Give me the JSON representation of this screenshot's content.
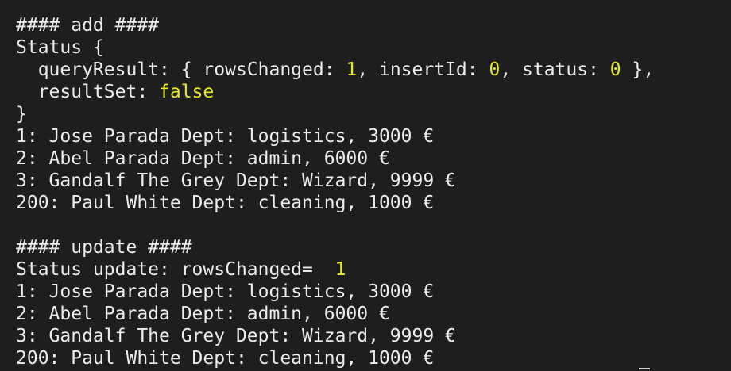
{
  "terminal": {
    "lines": {
      "add_header": "#### add ####",
      "status_open": "Status {",
      "query_result_prefix": "  queryResult: { rowsChanged: ",
      "rows_changed": "1",
      "insert_id_prefix": ", insertId: ",
      "insert_id": "0",
      "status_prefix": ", status: ",
      "status_value": "0",
      "query_result_suffix": " },",
      "result_set_prefix": "  resultSet: ",
      "result_set_value": "false",
      "status_close": "}",
      "rows_after_add": [
        "1: Jose Parada Dept: logistics, 3000 €",
        "2: Abel Parada Dept: admin, 6000 €",
        "3: Gandalf The Grey Dept: Wizard, 9999 €",
        "200: Paul White Dept: cleaning, 1000 €"
      ],
      "blank": "",
      "update_header": "#### update ####",
      "status_update_prefix": "Status update: rowsChanged=  ",
      "status_update_value": "1",
      "rows_after_update": [
        "1: Jose Parada Dept: logistics, 3000 €",
        "2: Abel Parada Dept: admin, 6000 €",
        "3: Gandalf The Grey Dept: Wizard, 9999 €",
        "200: Paul White Dept: cleaning, 1000 €"
      ]
    },
    "colors": {
      "background": "#1e1e1e",
      "text": "#ececec",
      "number_highlight": "#e6e62c"
    }
  }
}
